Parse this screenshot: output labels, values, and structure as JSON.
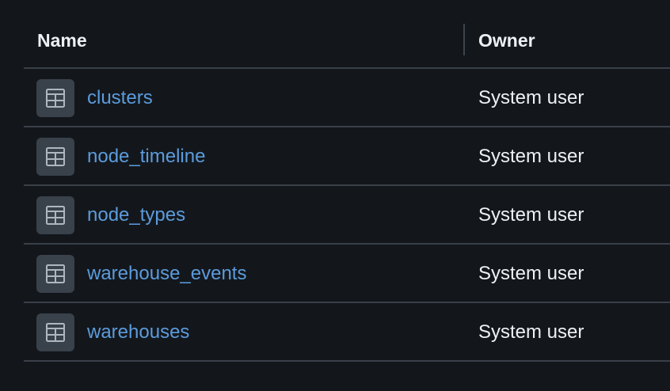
{
  "header": {
    "name_label": "Name",
    "owner_label": "Owner"
  },
  "rows": [
    {
      "name": "clusters",
      "owner": "System user",
      "icon": "table-icon"
    },
    {
      "name": "node_timeline",
      "owner": "System user",
      "icon": "table-icon"
    },
    {
      "name": "node_types",
      "owner": "System user",
      "icon": "table-icon"
    },
    {
      "name": "warehouse_events",
      "owner": "System user",
      "icon": "table-icon"
    },
    {
      "name": "warehouses",
      "owner": "System user",
      "icon": "table-icon"
    }
  ],
  "colors": {
    "background": "#13171c",
    "link": "#5c9bdb",
    "text": "#eef1f4",
    "icon_bg": "#39414a",
    "divider": "#3a4048"
  }
}
